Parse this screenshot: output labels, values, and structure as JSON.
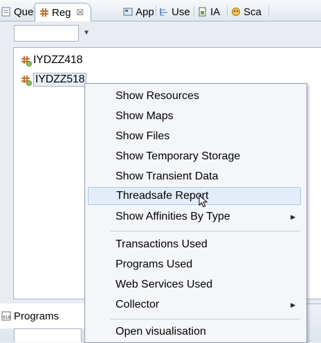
{
  "tabs": [
    {
      "label": "Que",
      "icon": "query-icon",
      "active": false
    },
    {
      "label": "Reg",
      "icon": "region-icon",
      "active": true,
      "close": "☒"
    },
    {
      "label": "App",
      "icon": "application-icon",
      "active": false
    },
    {
      "label": "Use",
      "icon": "usage-icon",
      "active": false
    },
    {
      "label": "IA",
      "icon": "ia-icon",
      "active": false
    },
    {
      "label": "Sca",
      "icon": "scanner-icon",
      "active": false
    }
  ],
  "combo": {
    "value": "",
    "arrow": "▼"
  },
  "tree": {
    "items": [
      {
        "label": "IYDZZ418",
        "selected": false
      },
      {
        "label": "IYDZZ518",
        "selected": true
      }
    ]
  },
  "menu": {
    "items": [
      {
        "label": "Show Resources"
      },
      {
        "label": "Show Maps"
      },
      {
        "label": "Show Files"
      },
      {
        "label": "Show Temporary Storage"
      },
      {
        "label": "Show Transient Data"
      },
      {
        "label": "Threadsafe Report",
        "hover": true
      },
      {
        "label": "Show Affinities By Type",
        "submenu": true
      },
      {
        "label": "Transactions Used"
      },
      {
        "label": "Programs Used"
      },
      {
        "label": "Web Services Used"
      },
      {
        "label": "Collector",
        "submenu": true
      },
      {
        "label": "Open visualisation"
      }
    ],
    "submenu_arrow": "▶"
  },
  "bottom": {
    "tab_label": "Programs",
    "tab_icon": "programs-icon",
    "input_value": ""
  },
  "colors": {
    "accent_hover": "#e3edfa",
    "hover_border": "#aac6ea",
    "region_icon": "#c0702a"
  }
}
